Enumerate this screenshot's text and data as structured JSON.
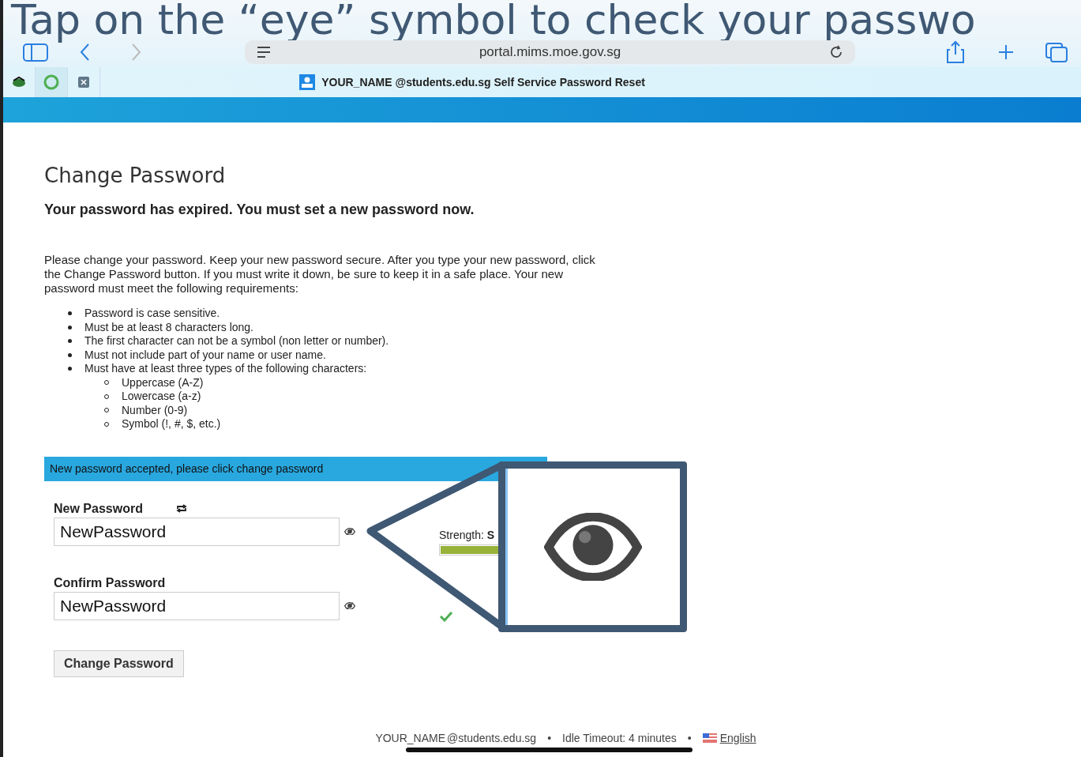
{
  "caption": "Tap on the “eye” symbol to check your passwo",
  "browser": {
    "url": "portal.mims.moe.gov.sg",
    "tabs": [
      {
        "selected": false
      },
      {
        "selected": true
      },
      {
        "selected": false
      }
    ],
    "tab_user": "YOUR_NAME",
    "tab_title": "@students.edu.sg Self Service Password Reset"
  },
  "page": {
    "title": "Change Password",
    "subtitle": "Your password has expired. You must set a new password now.",
    "intro": "Please change your password. Keep your new password secure. After you type your new password, click the Change Password button. If you must write it down, be sure to keep it in a safe place. Your new password must meet the following requirements:",
    "requirements": [
      {
        "text": "Password is case sensitive."
      },
      {
        "text": "Must be at least 8 characters long."
      },
      {
        "text": "The first character can not be a symbol (non letter or number)."
      },
      {
        "text": "Must not include part of your name or user name."
      },
      {
        "text": "Must have at least three types of the following characters:",
        "children": [
          {
            "text": "Uppercase (A-Z)"
          },
          {
            "text": "Lowercase (a-z)"
          },
          {
            "text": "Number (0-9)"
          },
          {
            "text": "Symbol (!, #, $, etc.)"
          }
        ]
      }
    ]
  },
  "alert": "New password accepted, please click change password",
  "fields": [
    {
      "label": "New Password",
      "value": "NewPassword",
      "generator": true
    },
    {
      "label": "Confirm Password",
      "value": "NewPassword",
      "generator": false
    }
  ],
  "strength": {
    "label": "Strength:",
    "value": "S",
    "level": 1
  },
  "match_ok": true,
  "button": "Change Password",
  "footer": [
    {
      "kind": "user",
      "text": "YOUR_NAME"
    },
    {
      "kind": "text",
      "text": "@students.edu.sg"
    },
    {
      "kind": "sep",
      "text": "•"
    },
    {
      "kind": "text",
      "text": "Idle Timeout: 4 minutes"
    },
    {
      "kind": "sep",
      "text": "•"
    },
    {
      "kind": "lang",
      "text": "English"
    }
  ]
}
